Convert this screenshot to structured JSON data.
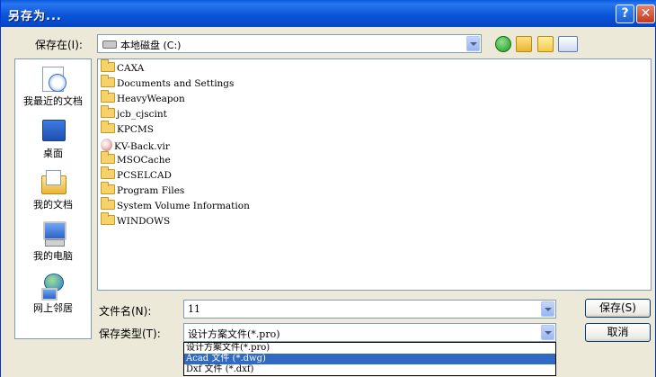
{
  "window": {
    "title": "另存为..."
  },
  "toolbar": {
    "save_in_label": "保存在(I):",
    "location": "本地磁盘 (C:)",
    "icons": [
      "back-icon",
      "up-folder-icon",
      "new-folder-icon",
      "view-menu-icon"
    ]
  },
  "places": [
    {
      "label": "我最近的文档",
      "icon": "recent-documents-icon"
    },
    {
      "label": "桌面",
      "icon": "desktop-icon"
    },
    {
      "label": "我的文档",
      "icon": "my-documents-icon"
    },
    {
      "label": "我的电脑",
      "icon": "my-computer-icon"
    },
    {
      "label": "网上邻居",
      "icon": "network-places-icon"
    }
  ],
  "files": [
    {
      "name": "CAXA",
      "type": "folder"
    },
    {
      "name": "Documents and Settings",
      "type": "folder"
    },
    {
      "name": "HeavyWeapon",
      "type": "folder"
    },
    {
      "name": "jcb_cjscint",
      "type": "folder"
    },
    {
      "name": "KPCMS",
      "type": "folder"
    },
    {
      "name": "KV-Back.vir",
      "type": "file"
    },
    {
      "name": "MSOCache",
      "type": "folder"
    },
    {
      "name": "PCSELCAD",
      "type": "folder"
    },
    {
      "name": "Program Files",
      "type": "folder"
    },
    {
      "name": "System Volume Information",
      "type": "folder"
    },
    {
      "name": "WINDOWS",
      "type": "folder"
    }
  ],
  "form": {
    "filename_label": "文件名(N):",
    "filename_value": "11",
    "filetype_label": "保存类型(T):",
    "filetype_value": "设计方案文件(*.pro)",
    "filetype_options": [
      "设计方案文件(*.pro)",
      "Acad 文件 (*.dwg)",
      "Dxf 文件 (*.dxf)"
    ],
    "selected_option_index": 1
  },
  "buttons": {
    "save": "保存(S)",
    "cancel": "取消"
  }
}
